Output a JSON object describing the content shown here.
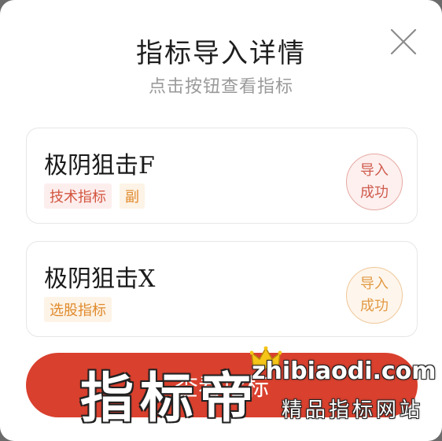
{
  "dialog": {
    "title": "指标导入详情",
    "subtitle": "点击按钮查看指标"
  },
  "indicators": [
    {
      "name": "极阴狙击F",
      "tags": [
        "技术指标",
        "副"
      ],
      "status_line1": "导入",
      "status_line2": "成功"
    },
    {
      "name": "极阴狙击X",
      "tags": [
        "选股指标"
      ],
      "status_line1": "导入",
      "status_line2": "成功"
    }
  ],
  "action_button": {
    "label": "查看指标"
  },
  "watermark": {
    "brand": "指标帝",
    "url": "zhibiaodi.com",
    "slogan": "精品指标网站"
  },
  "colors": {
    "primary_red": "#d9402e",
    "tag_red": "#d2553f",
    "tag_orange": "#e08a2c"
  },
  "icons": {
    "close": "close-icon",
    "crown": "crown-icon"
  }
}
